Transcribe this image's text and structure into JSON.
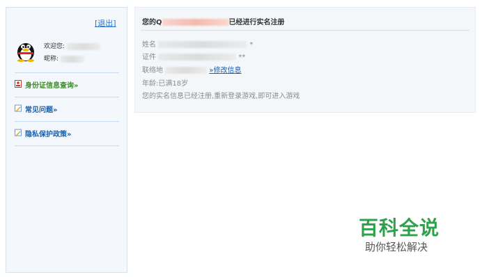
{
  "sidebar": {
    "logout": "[退出]",
    "welcome_label": "欢迎您:",
    "nickname_label": "昵称:",
    "nav": [
      {
        "label": "身份证信息查询»",
        "icon": "id-card-icon",
        "color": "#3f8a2a"
      },
      {
        "label": "常见问题»",
        "icon": "pencil-icon",
        "color": "#1c5fa8"
      },
      {
        "label": "隐私保护政策»",
        "icon": "pencil-icon",
        "color": "#1c5fa8"
      }
    ]
  },
  "main": {
    "title_prefix": "您的Q",
    "title_suffix": "已经进行实名注册",
    "name_label": "姓名",
    "name_tail": "*",
    "id_label": "证件",
    "id_tail": "**",
    "contact_label": "联络地",
    "modify_link": "»修改信息",
    "age": "年龄:已满18岁",
    "note": "您的实名信息已经注册,重新登录游戏,即可进入游戏"
  },
  "watermark": {
    "title": "百科全说",
    "subtitle": "助你轻松解决"
  }
}
